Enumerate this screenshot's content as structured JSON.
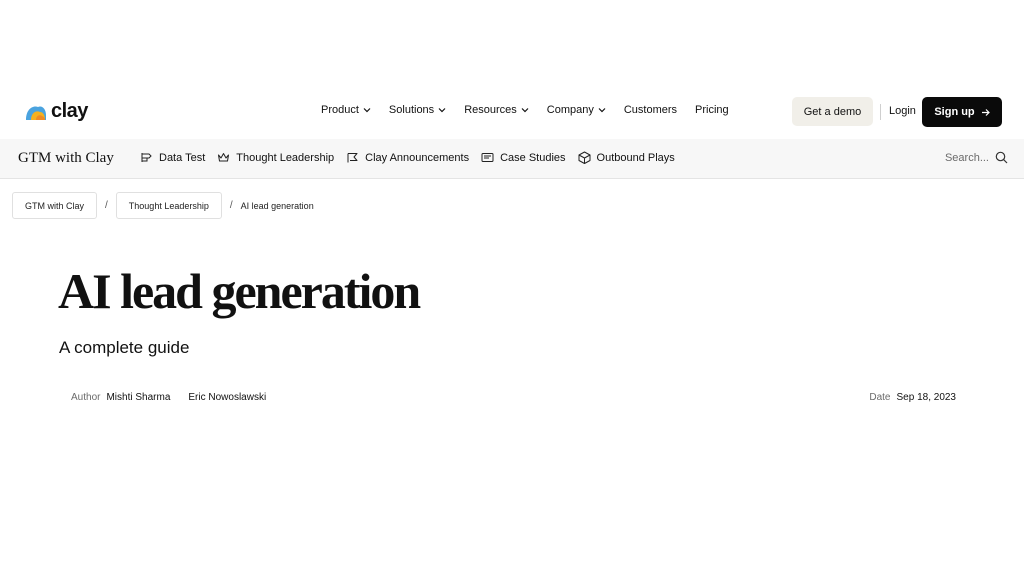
{
  "brand": {
    "logo_text": "clay",
    "logo_icon": "clay-logo-icon"
  },
  "nav": {
    "items": [
      {
        "label": "Product",
        "has_dropdown": true
      },
      {
        "label": "Solutions",
        "has_dropdown": true
      },
      {
        "label": "Resources",
        "has_dropdown": true
      },
      {
        "label": "Company",
        "has_dropdown": true
      },
      {
        "label": "Customers",
        "has_dropdown": false
      },
      {
        "label": "Pricing",
        "has_dropdown": false
      }
    ],
    "demo_label": "Get a demo",
    "login_label": "Login",
    "signup_label": "Sign up"
  },
  "subnav": {
    "brand": "GTM with Clay",
    "items": [
      {
        "label": "Data Test",
        "icon": "data-test-icon"
      },
      {
        "label": "Thought Leadership",
        "icon": "crown-icon"
      },
      {
        "label": "Clay Announcements",
        "icon": "megaphone-icon"
      },
      {
        "label": "Case Studies",
        "icon": "case-study-icon"
      },
      {
        "label": "Outbound Plays",
        "icon": "cube-icon"
      }
    ],
    "search_placeholder": "Search..."
  },
  "breadcrumb": {
    "items": [
      "GTM with Clay",
      "Thought Leadership",
      "AI lead generation"
    ],
    "separator": "/"
  },
  "article": {
    "title": "AI lead generation",
    "subtitle": "A complete guide",
    "author_label": "Author",
    "authors": [
      "Mishti Sharma",
      "Eric Nowoslawski"
    ],
    "date_label": "Date",
    "date": "Sep 18, 2023"
  },
  "colors": {
    "signup_bg": "#0a0a0a",
    "demo_bg": "#f1efe9",
    "subnav_bg": "#f7f7f7"
  }
}
